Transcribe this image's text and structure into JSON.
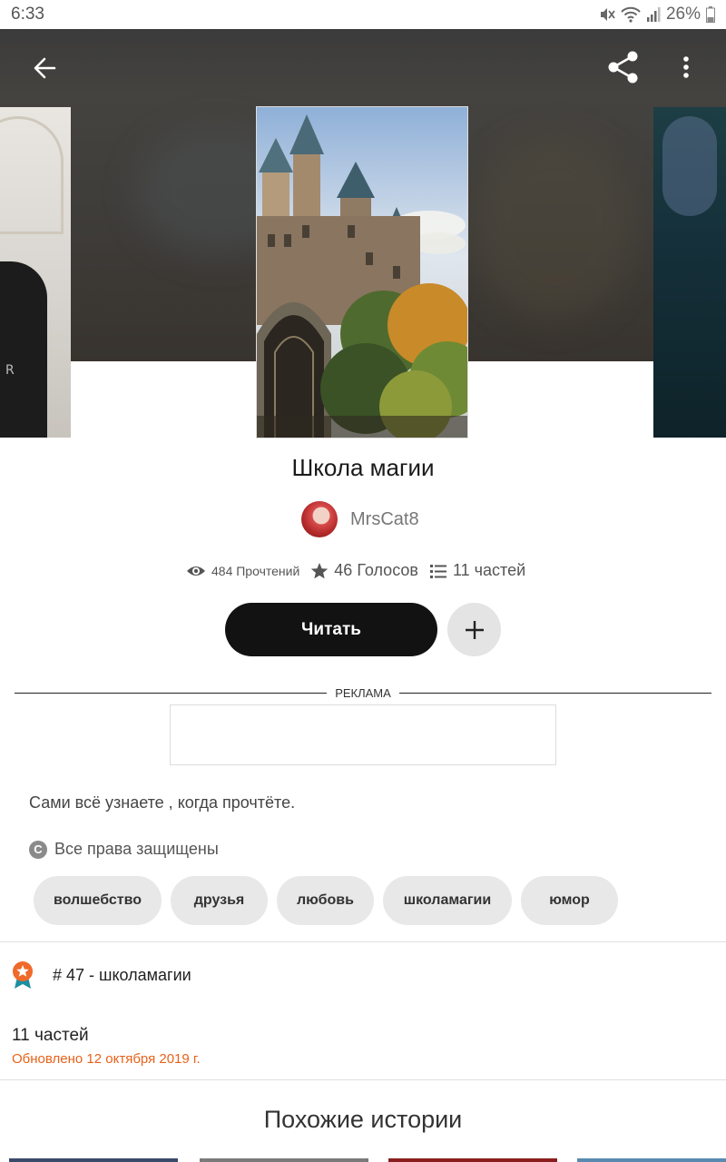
{
  "status_bar": {
    "time": "6:33",
    "battery": "26%"
  },
  "header": {
    "back_icon": "arrow-left-icon",
    "share_icon": "share-icon",
    "more_icon": "more-vert-icon"
  },
  "story": {
    "title": "Школа магии",
    "author": "MrsCat8",
    "stats": {
      "reads": "484 Прочтений",
      "votes": "46 Голосов",
      "parts": "11 частей"
    },
    "read_button": "Читать",
    "add_icon": "plus-icon",
    "ad_label": "РЕКЛАМА",
    "description": "Сами всё узнаете , когда прочтёте.",
    "copyright": "Все права защищены",
    "copyright_icon_glyph": "C",
    "tags": [
      "волшебство",
      "друзья",
      "любовь",
      "школамагии",
      "юмор"
    ],
    "rank": "# 47 - школамагии",
    "parts_title": "11 частей",
    "updated": "Обновлено 12 октября 2019 г.",
    "similar_title": "Похожие истории"
  },
  "colors": {
    "accent_orange": "#e8621a",
    "button_dark": "#121212",
    "tag_bg": "#e8e8e8"
  }
}
